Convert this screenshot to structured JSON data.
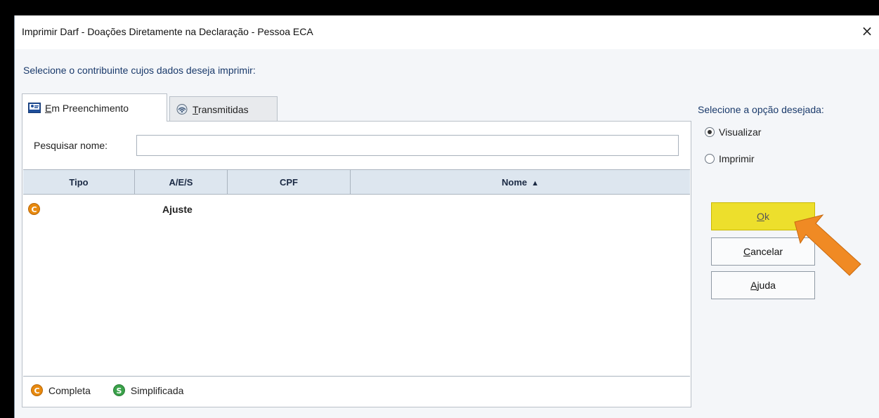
{
  "dialog": {
    "title": "Imprimir Darf - Doações Diretamente na Declaração - Pessoa ECA",
    "prompt": "Selecione o contribuinte cujos dados deseja imprimir:"
  },
  "tabs": [
    {
      "label_first": "E",
      "label_rest": "m Preenchimento",
      "icon": "person-card-icon",
      "active": true
    },
    {
      "label_first": "T",
      "label_rest": "ransmitidas",
      "icon": "transmission-icon",
      "active": false
    }
  ],
  "search": {
    "label": "Pesquisar nome:",
    "value": "",
    "placeholder": ""
  },
  "grid": {
    "columns": [
      "Tipo",
      "A/E/S",
      "CPF",
      "Nome"
    ],
    "sort_indicator": "▲",
    "rows": [
      {
        "tipo_badge": "C",
        "aes": "Ajuste",
        "cpf": "",
        "nome": ""
      }
    ]
  },
  "legend": [
    {
      "badge": "C",
      "label": "Completa"
    },
    {
      "badge": "S",
      "label": "Simplificada"
    }
  ],
  "options": {
    "title": "Selecione a opção desejada:",
    "radios": [
      {
        "label": "Visualizar",
        "checked": true
      },
      {
        "label": "Imprimir",
        "checked": false
      }
    ]
  },
  "buttons": {
    "ok_first": "O",
    "ok_rest": "k",
    "cancel_first": "C",
    "cancel_rest": "ancelar",
    "help_first": "A",
    "help_rest": "juda"
  },
  "colors": {
    "highlight": "#eddf2c",
    "arrow": "#f08a24",
    "completa_badge": "#e88a0f",
    "simplificada_badge": "#3aa24a"
  },
  "icons": {
    "close": "×"
  }
}
